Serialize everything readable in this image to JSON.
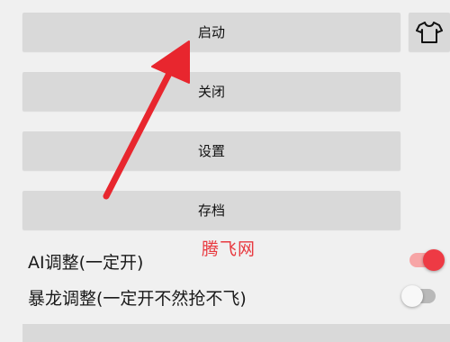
{
  "buttons": {
    "start": "启动",
    "close": "关闭",
    "settings": "设置",
    "save": "存档"
  },
  "icon_button": {
    "icon": "tshirt-icon"
  },
  "watermark": "腾飞网",
  "toggles": [
    {
      "label": "AI调整(一定开)",
      "state": "on"
    },
    {
      "label": "暴龙调整(一定开不然抢不飞)",
      "state": "off"
    }
  ],
  "colors": {
    "accent": "#ee3a44",
    "button_bg": "#d9d9d9",
    "arrow": "#e8262e"
  }
}
